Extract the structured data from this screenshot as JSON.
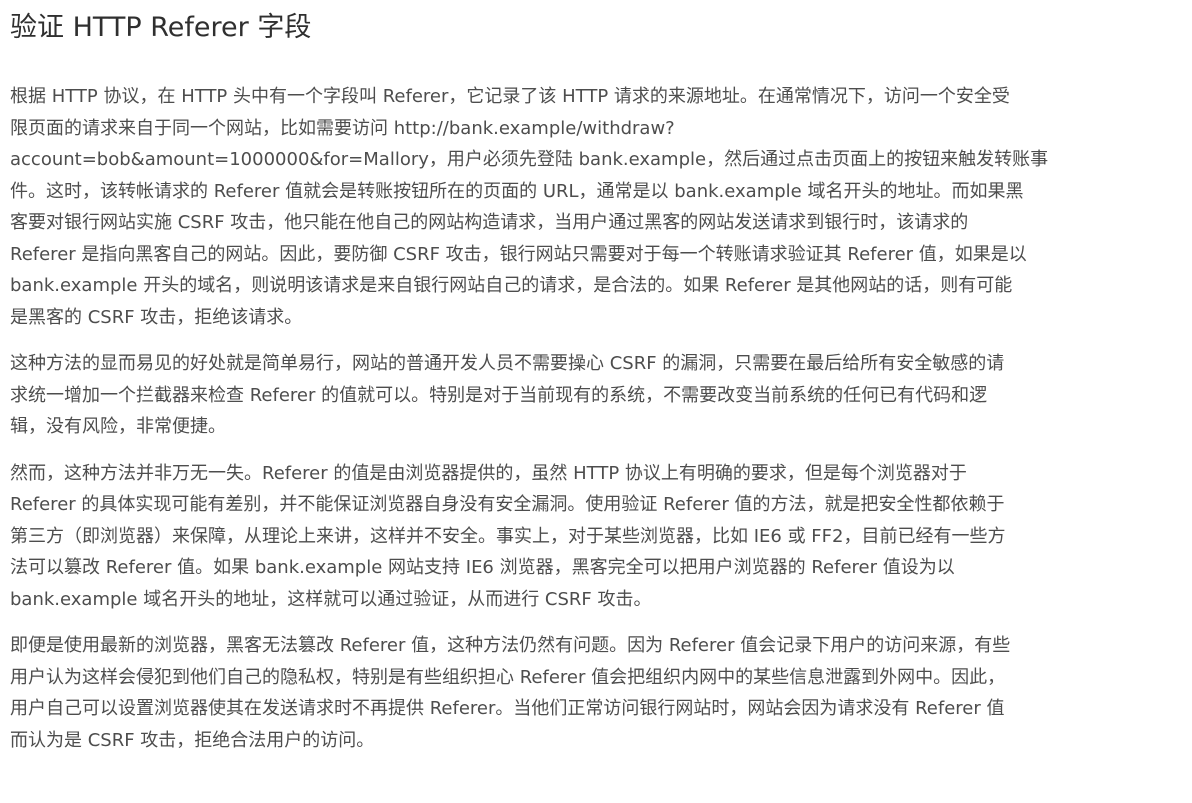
{
  "article": {
    "title": "验证 HTTP Referer 字段",
    "paragraphs": [
      {
        "lines": [
          "根据 HTTP 协议，在 HTTP 头中有一个字段叫 Referer，它记录了该 HTTP 请求的来源地址。在通常情况下，访问一个安全受",
          "限页面的请求来自于同一个网站，比如需要访问 http://bank.example/withdraw?",
          "account=bob&amount=1000000&for=Mallory，用户必须先登陆 bank.example，然后通过点击页面上的按钮来触发转账事",
          "件。这时，该转帐请求的 Referer 值就会是转账按钮所在的页面的 URL，通常是以 bank.example 域名开头的地址。而如果黑",
          "客要对银行网站实施 CSRF 攻击，他只能在他自己的网站构造请求，当用户通过黑客的网站发送请求到银行时，该请求的",
          "Referer 是指向黑客自己的网站。因此，要防御 CSRF 攻击，银行网站只需要对于每一个转账请求验证其 Referer 值，如果是以",
          "bank.example 开头的域名，则说明该请求是来自银行网站自己的请求，是合法的。如果 Referer 是其他网站的话，则有可能",
          "是黑客的 CSRF 攻击，拒绝该请求。"
        ]
      },
      {
        "lines": [
          "这种方法的显而易见的好处就是简单易行，网站的普通开发人员不需要操心 CSRF 的漏洞，只需要在最后给所有安全敏感的请",
          "求统一增加一个拦截器来检查 Referer 的值就可以。特别是对于当前现有的系统，不需要改变当前系统的任何已有代码和逻",
          "辑，没有风险，非常便捷。"
        ]
      },
      {
        "lines": [
          "然而，这种方法并非万无一失。Referer 的值是由浏览器提供的，虽然 HTTP 协议上有明确的要求，但是每个浏览器对于",
          "Referer 的具体实现可能有差别，并不能保证浏览器自身没有安全漏洞。使用验证 Referer 值的方法，就是把安全性都依赖于",
          "第三方（即浏览器）来保障，从理论上来讲，这样并不安全。事实上，对于某些浏览器，比如 IE6 或 FF2，目前已经有一些方",
          "法可以篡改 Referer 值。如果 bank.example 网站支持 IE6 浏览器，黑客完全可以把用户浏览器的 Referer 值设为以",
          "bank.example 域名开头的地址，这样就可以通过验证，从而进行 CSRF 攻击。"
        ]
      },
      {
        "lines": [
          "即便是使用最新的浏览器，黑客无法篡改 Referer 值，这种方法仍然有问题。因为 Referer 值会记录下用户的访问来源，有些",
          "用户认为这样会侵犯到他们自己的隐私权，特别是有些组织担心 Referer 值会把组织内网中的某些信息泄露到外网中。因此，",
          "用户自己可以设置浏览器使其在发送请求时不再提供 Referer。当他们正常访问银行网站时，网站会因为请求没有 Referer 值",
          "而认为是 CSRF 攻击，拒绝合法用户的访问。"
        ]
      }
    ]
  }
}
